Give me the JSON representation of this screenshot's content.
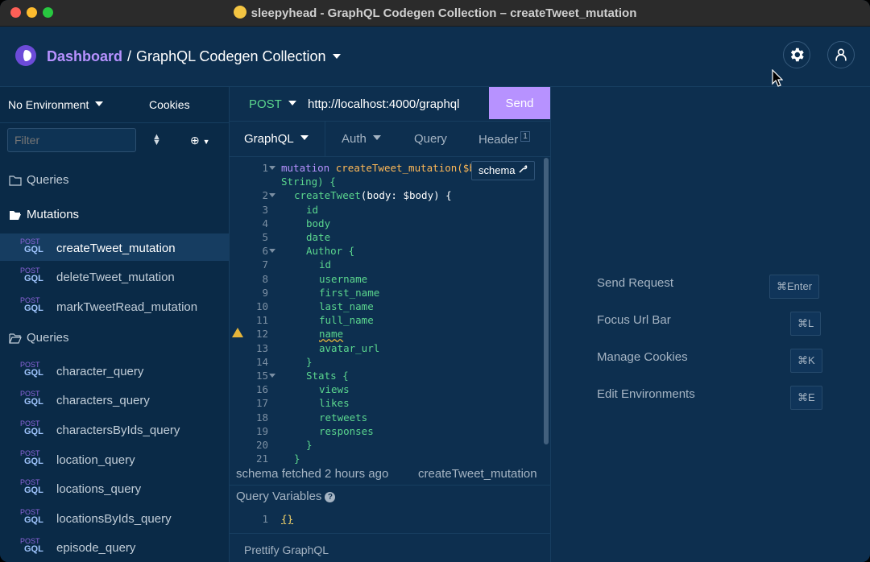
{
  "window": {
    "title": "sleepyhead - GraphQL Codegen Collection – createTweet_mutation"
  },
  "header": {
    "dashboard": "Dashboard",
    "separator": "/",
    "collection": "GraphQL Codegen Collection"
  },
  "sidebar": {
    "environment": "No Environment",
    "cookies": "Cookies",
    "filter_placeholder": "Filter",
    "folders": [
      {
        "label": "Queries",
        "open": false
      },
      {
        "label": "Mutations",
        "open": true
      },
      {
        "label": "Queries",
        "open": true
      }
    ],
    "method_badge": "POST",
    "type_badge": "GQL",
    "mutations": [
      "createTweet_mutation",
      "deleteTweet_mutation",
      "markTweetRead_mutation"
    ],
    "queries": [
      "character_query",
      "characters_query",
      "charactersByIds_query",
      "location_query",
      "locations_query",
      "locationsByIds_query",
      "episode_query"
    ]
  },
  "request": {
    "method": "POST",
    "url": "http://localhost:4000/graphql",
    "send": "Send"
  },
  "tabs": {
    "graphql": "GraphQL",
    "auth": "Auth",
    "query": "Query",
    "header": "Header",
    "header_count": "1"
  },
  "editor": {
    "schema_button": "schema",
    "line1_kw": "mutation",
    "line1_fn": "createTweet_mutation(",
    "line1_var": "$body",
    "line1b": "String) {",
    "line2_fn": "createTweet",
    "line2_rest": "(body: $body) {",
    "fields": [
      "id",
      "body",
      "date",
      "Author {",
      "id",
      "username",
      "first_name",
      "last_name",
      "full_name",
      "name",
      "avatar_url",
      "}",
      "Stats {",
      "views",
      "likes",
      "retweets",
      "responses",
      "}",
      "}"
    ],
    "line_numbers": [
      "1",
      "2",
      "3",
      "4",
      "5",
      "6",
      "7",
      "8",
      "9",
      "10",
      "11",
      "12",
      "13",
      "14",
      "15",
      "16",
      "17",
      "18",
      "19",
      "20",
      "21"
    ]
  },
  "status": {
    "fetched": "schema fetched 2 hours ago",
    "operation": "createTweet_mutation"
  },
  "variables": {
    "title": "Query Variables",
    "help": "?",
    "line_no": "1",
    "value": "{}"
  },
  "footer": {
    "prettify": "Prettify GraphQL"
  },
  "shortcuts": [
    {
      "label": "Send Request",
      "key": "⌘Enter"
    },
    {
      "label": "Focus Url Bar",
      "key": "⌘L"
    },
    {
      "label": "Manage Cookies",
      "key": "⌘K"
    },
    {
      "label": "Edit Environments",
      "key": "⌘E"
    }
  ]
}
